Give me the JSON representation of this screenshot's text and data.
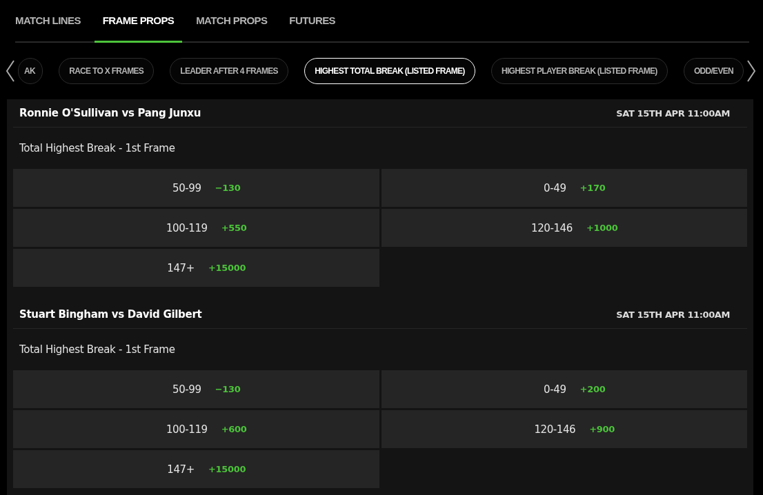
{
  "tabs": [
    {
      "label": "MATCH LINES",
      "selected": false
    },
    {
      "label": "FRAME PROPS",
      "selected": true
    },
    {
      "label": "MATCH PROPS",
      "selected": false
    },
    {
      "label": "FUTURES",
      "selected": false
    }
  ],
  "markets_filter": [
    {
      "label": "AK",
      "selected": false
    },
    {
      "label": "RACE TO X FRAMES",
      "selected": false
    },
    {
      "label": "LEADER AFTER 4 FRAMES",
      "selected": false
    },
    {
      "label": "HIGHEST TOTAL BREAK (LISTED FRAME)",
      "selected": true
    },
    {
      "label": "HIGHEST PLAYER BREAK (LISTED FRAME)",
      "selected": false
    },
    {
      "label": "ODD/EVEN",
      "selected": false
    }
  ],
  "matches": [
    {
      "title": "Ronnie O'Sullivan vs Pang Junxu",
      "time": "SAT 15TH APR 11:00AM",
      "market": "Total Highest Break - 1st Frame",
      "outcomes": [
        {
          "label": "50-99",
          "odds": "−130"
        },
        {
          "label": "0-49",
          "odds": "+170"
        },
        {
          "label": "100-119",
          "odds": "+550"
        },
        {
          "label": "120-146",
          "odds": "+1000"
        },
        {
          "label": "147+",
          "odds": "+15000"
        }
      ]
    },
    {
      "title": "Stuart Bingham vs David Gilbert",
      "time": "SAT 15TH APR 11:00AM",
      "market": "Total Highest Break - 1st Frame",
      "outcomes": [
        {
          "label": "50-99",
          "odds": "−130"
        },
        {
          "label": "0-49",
          "odds": "+200"
        },
        {
          "label": "100-119",
          "odds": "+600"
        },
        {
          "label": "120-146",
          "odds": "+900"
        },
        {
          "label": "147+",
          "odds": "+15000"
        }
      ]
    }
  ]
}
